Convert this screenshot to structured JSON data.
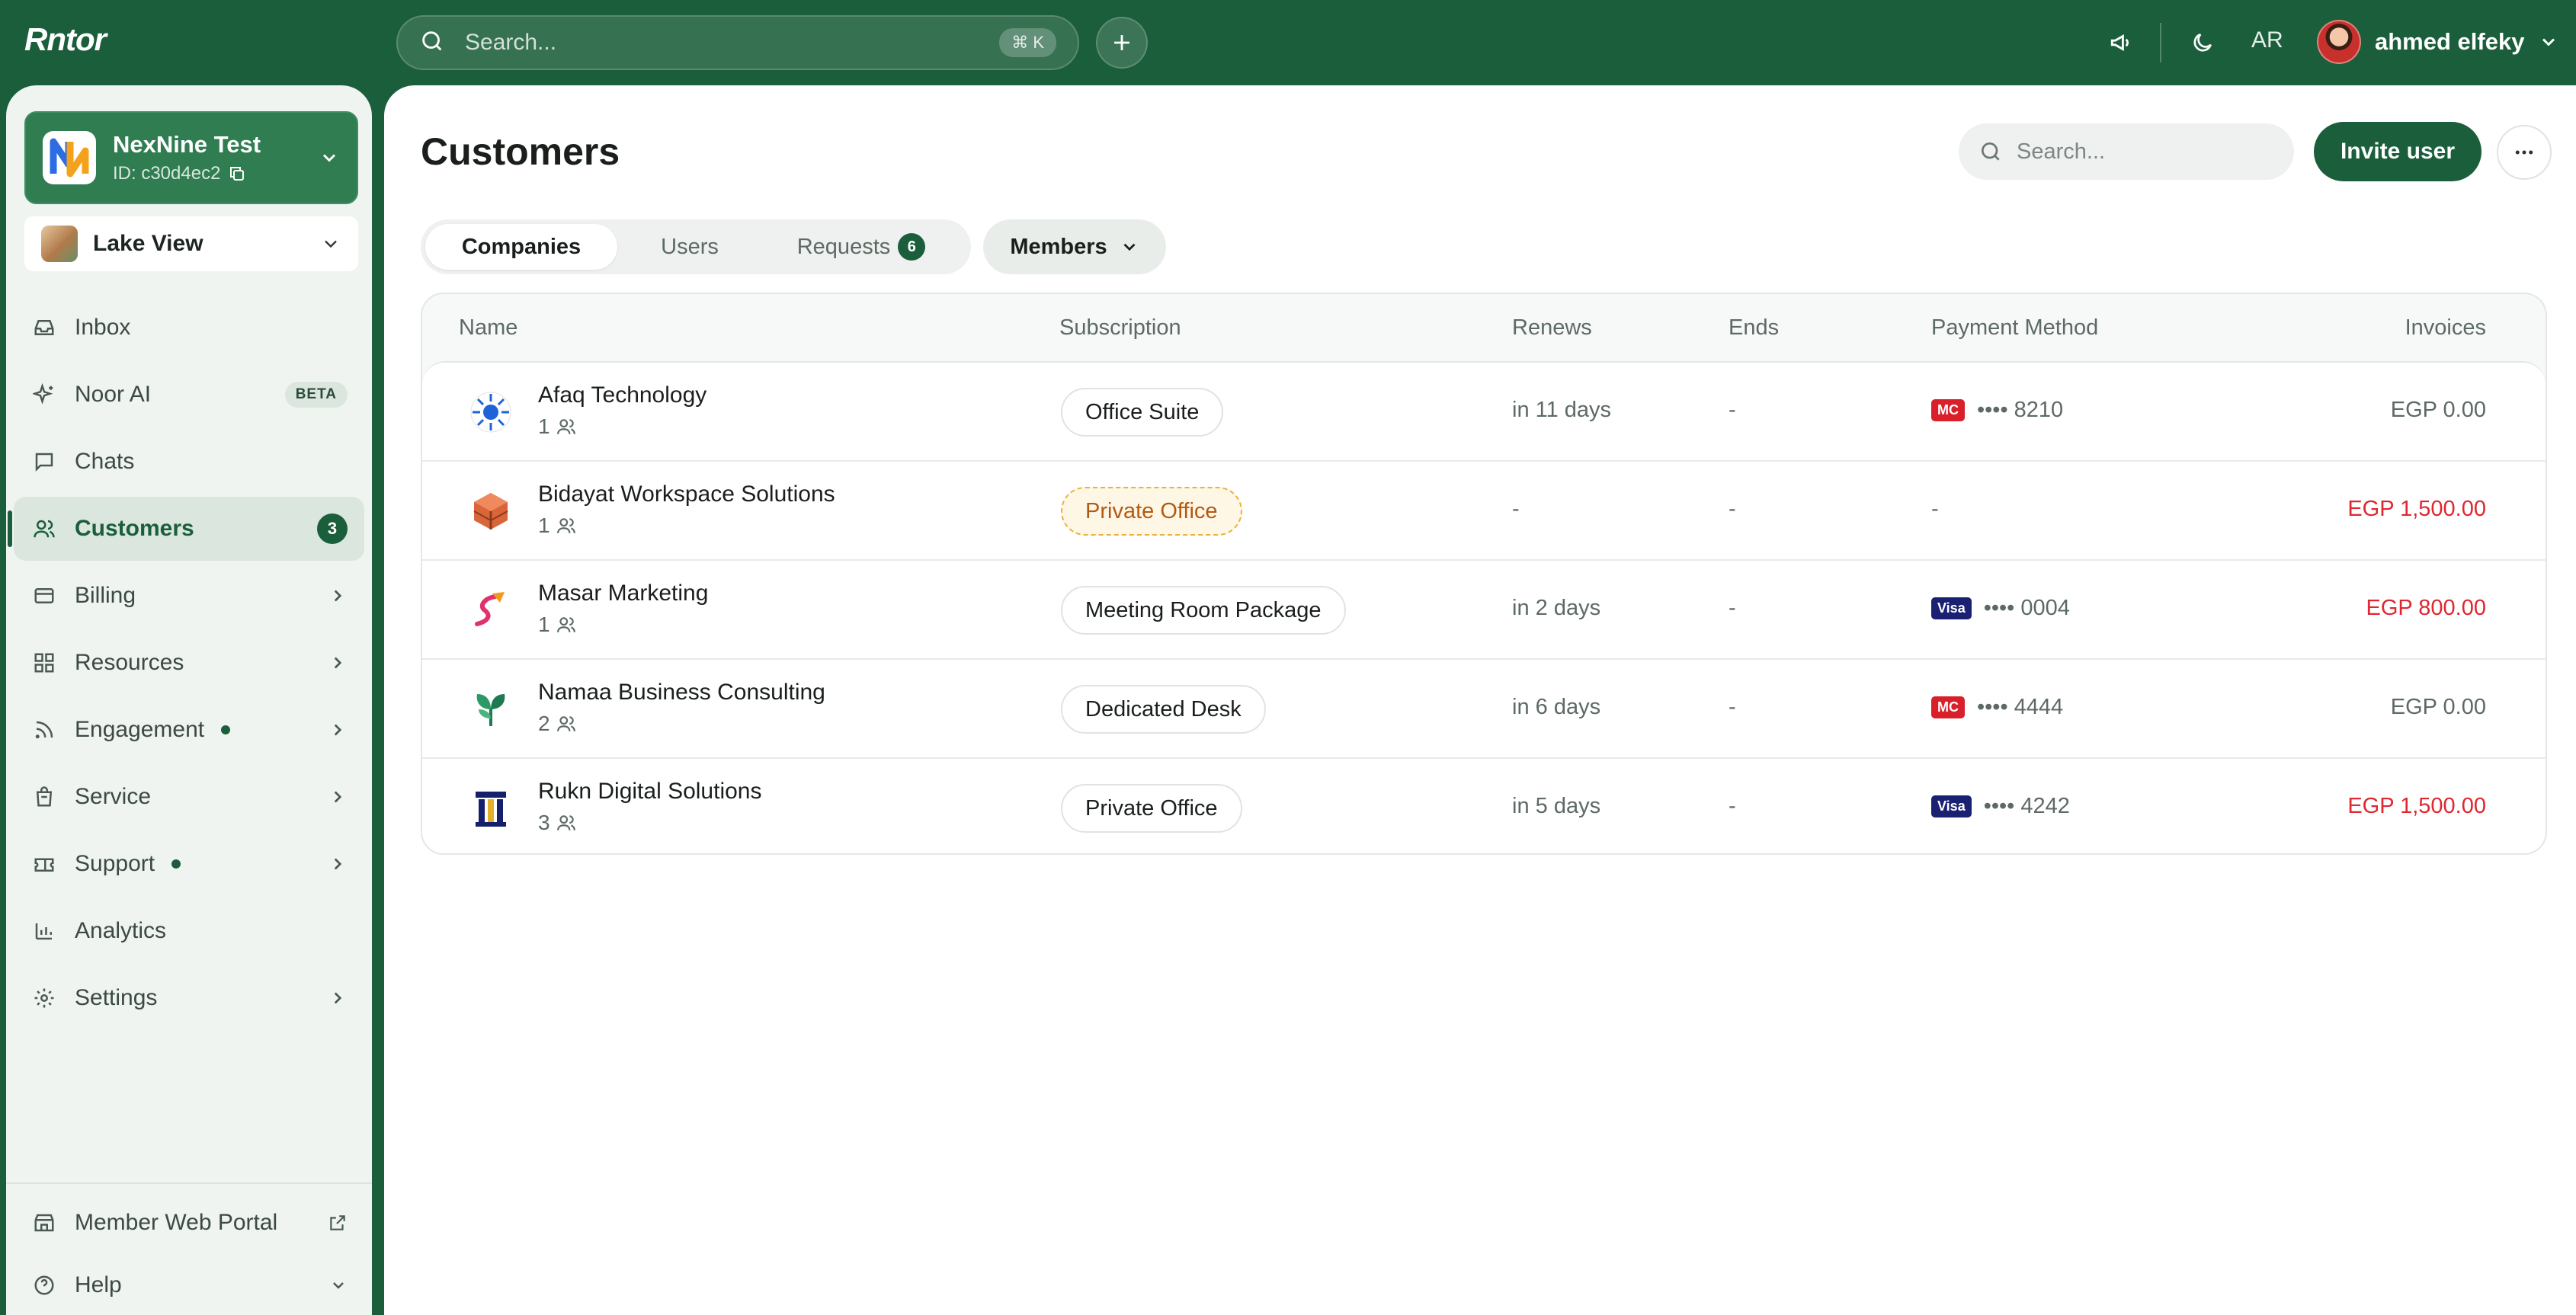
{
  "app": {
    "logo": "Rntor"
  },
  "topbar": {
    "search_placeholder": "Search...",
    "search_shortcut": "⌘ K",
    "language": "AR",
    "user_name": "ahmed elfeky",
    "icons": [
      "search-icon",
      "plus-icon",
      "megaphone-icon",
      "moon-icon",
      "chevron-down-icon"
    ]
  },
  "workspace": {
    "name": "NexNine Test",
    "id": "ID: c30d4ec2"
  },
  "location": {
    "name": "Lake View"
  },
  "sidebar": {
    "items": [
      {
        "label": "Inbox",
        "icon": "inbox-icon"
      },
      {
        "label": "Noor AI",
        "icon": "sparkle-icon",
        "badge": "BETA"
      },
      {
        "label": "Chats",
        "icon": "chat-icon"
      },
      {
        "label": "Customers",
        "icon": "users-icon",
        "count": "3",
        "active": true
      },
      {
        "label": "Billing",
        "icon": "card-icon",
        "chevron": true
      },
      {
        "label": "Resources",
        "icon": "grid-icon",
        "chevron": true
      },
      {
        "label": "Engagement",
        "icon": "rss-icon",
        "dot": true,
        "chevron": true
      },
      {
        "label": "Service",
        "icon": "bag-icon",
        "chevron": true
      },
      {
        "label": "Support",
        "icon": "ticket-icon",
        "dot": true,
        "chevron": true
      },
      {
        "label": "Analytics",
        "icon": "bar-chart-icon"
      },
      {
        "label": "Settings",
        "icon": "gear-icon",
        "chevron": true
      }
    ],
    "bottom": [
      {
        "label": "Member Web Portal",
        "icon": "store-icon"
      },
      {
        "label": "Help",
        "icon": "help-icon"
      }
    ]
  },
  "main": {
    "title": "Customers",
    "search_placeholder": "Search...",
    "invite_label": "Invite user",
    "tabs": [
      {
        "label": "Companies",
        "active": true
      },
      {
        "label": "Users"
      },
      {
        "label": "Requests",
        "count": "6"
      }
    ],
    "filter_label": "Members"
  },
  "table": {
    "headers": {
      "name": "Name",
      "subscription": "Subscription",
      "renews": "Renews",
      "ends": "Ends",
      "payment": "Payment Method",
      "invoices": "Invoices"
    },
    "rows": [
      {
        "name": "Afaq Technology",
        "members": "1",
        "subscription": "Office Suite",
        "pending": false,
        "renews": "in 11 days",
        "ends": "-",
        "card": "MC",
        "last4": "•••• 8210",
        "invoice": "EGP 0.00",
        "overdue": false
      },
      {
        "name": "Bidayat Workspace Solutions",
        "members": "1",
        "subscription": "Private Office",
        "pending": true,
        "renews": "-",
        "ends": "-",
        "card": "",
        "last4": "-",
        "invoice": "EGP 1,500.00",
        "overdue": true
      },
      {
        "name": "Masar Marketing",
        "members": "1",
        "subscription": "Meeting Room Package",
        "pending": false,
        "renews": "in 2 days",
        "ends": "-",
        "card": "Visa",
        "last4": "•••• 0004",
        "invoice": "EGP 800.00",
        "overdue": true
      },
      {
        "name": "Namaa Business Consulting",
        "members": "2",
        "subscription": "Dedicated Desk",
        "pending": false,
        "renews": "in 6 days",
        "ends": "-",
        "card": "MC",
        "last4": "•••• 4444",
        "invoice": "EGP 0.00",
        "overdue": false
      },
      {
        "name": "Rukn Digital Solutions",
        "members": "3",
        "subscription": "Private Office",
        "pending": false,
        "renews": "in 5 days",
        "ends": "-",
        "card": "Visa",
        "last4": "•••• 4242",
        "invoice": "EGP 1,500.00",
        "overdue": true
      }
    ]
  },
  "colors": {
    "brand": "#1b5e3b",
    "danger": "#e0262f",
    "pending": "#b35a12"
  }
}
